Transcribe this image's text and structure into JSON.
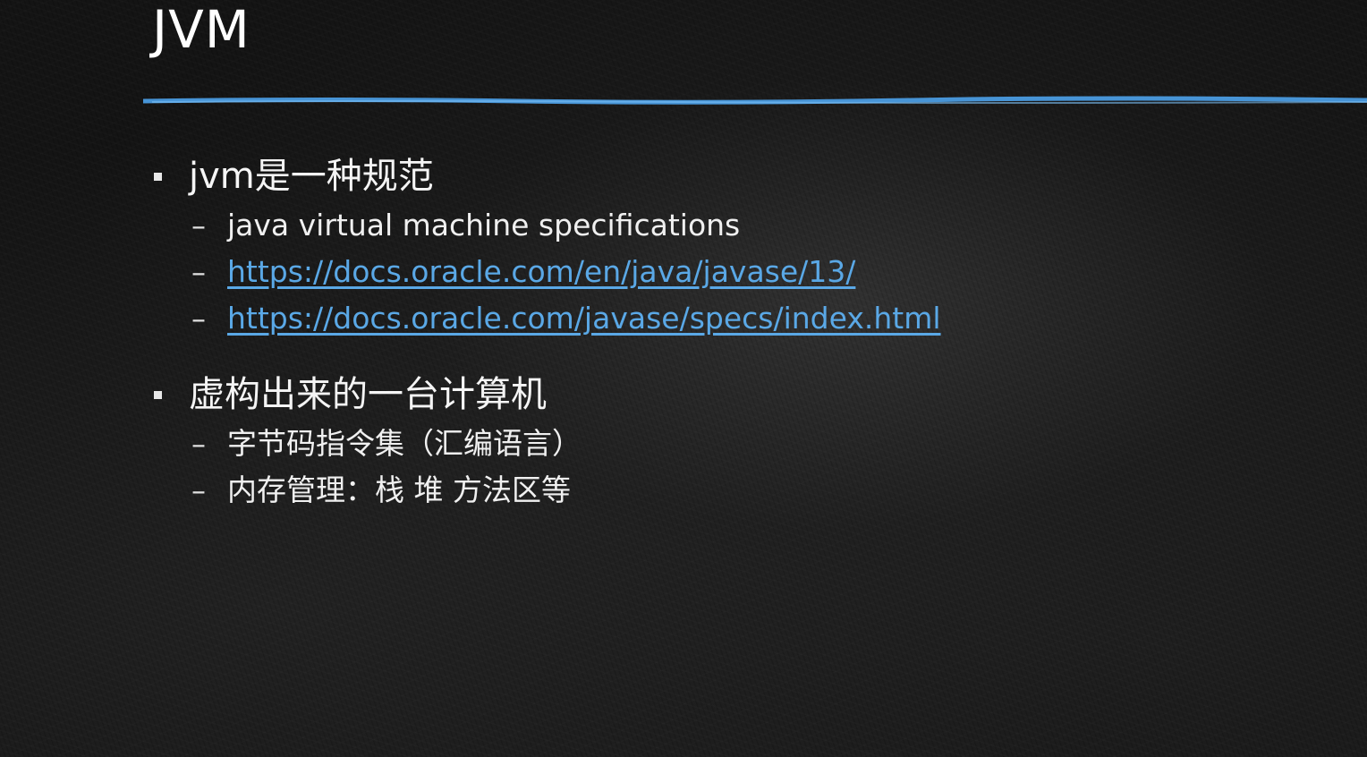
{
  "slide": {
    "title": "JVM",
    "accent_color": "#4a9be0",
    "link_color": "#5aa8e6",
    "bullets": [
      {
        "text": "jvm是一种规范",
        "subitems": [
          {
            "text": "java virtual machine specifications",
            "is_link": false
          },
          {
            "text": "https://docs.oracle.com/en/java/javase/13/",
            "is_link": true
          },
          {
            "text": "https://docs.oracle.com/javase/specs/index.html",
            "is_link": true
          }
        ]
      },
      {
        "text": "虚构出来的一台计算机",
        "subitems": [
          {
            "text": "字节码指令集（汇编语言）",
            "is_link": false
          },
          {
            "text": "内存管理：栈 堆 方法区等",
            "is_link": false
          }
        ]
      }
    ],
    "dash_glyph": "–"
  }
}
